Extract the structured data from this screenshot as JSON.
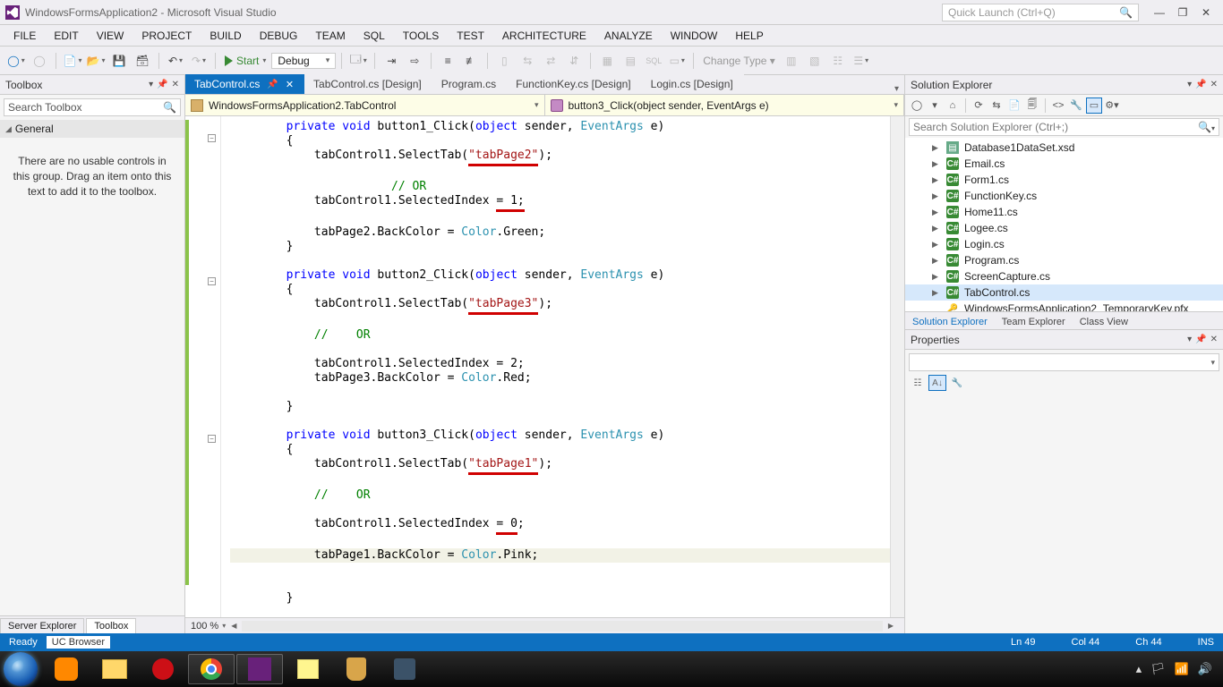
{
  "title": "WindowsFormsApplication2 - Microsoft Visual Studio",
  "quicklaunch_placeholder": "Quick Launch (Ctrl+Q)",
  "menu": [
    "FILE",
    "EDIT",
    "VIEW",
    "PROJECT",
    "BUILD",
    "DEBUG",
    "TEAM",
    "SQL",
    "TOOLS",
    "TEST",
    "ARCHITECTURE",
    "ANALYZE",
    "WINDOW",
    "HELP"
  ],
  "toolbar": {
    "start_label": "Start",
    "config": "Debug",
    "change_type": "Change Type"
  },
  "toolbox": {
    "title": "Toolbox",
    "search_placeholder": "Search Toolbox",
    "group": "General",
    "empty_msg": "There are no usable controls in this group. Drag an item onto this text to add it to the toolbox.",
    "bottom_tabs": [
      "Server Explorer",
      "Toolbox"
    ]
  },
  "editor_tabs": [
    {
      "label": "TabControl.cs",
      "active": true,
      "pinned": true
    },
    {
      "label": "TabControl.cs [Design]"
    },
    {
      "label": "Program.cs"
    },
    {
      "label": "FunctionKey.cs [Design]"
    },
    {
      "label": "Login.cs [Design]"
    }
  ],
  "nav": {
    "class": "WindowsFormsApplication2.TabControl",
    "member": "button3_Click(object sender, EventArgs e)"
  },
  "zoom": "100 %",
  "solution_explorer": {
    "title": "Solution Explorer",
    "search_placeholder": "Search Solution Explorer (Ctrl+;)",
    "items": [
      {
        "name": "Database1DataSet.xsd",
        "icon": "xsd"
      },
      {
        "name": "Email.cs",
        "icon": "cs"
      },
      {
        "name": "Form1.cs",
        "icon": "cs"
      },
      {
        "name": "FunctionKey.cs",
        "icon": "cs"
      },
      {
        "name": "Home11.cs",
        "icon": "cs"
      },
      {
        "name": "Logee.cs",
        "icon": "cs"
      },
      {
        "name": "Login.cs",
        "icon": "cs"
      },
      {
        "name": "Program.cs",
        "icon": "csplain"
      },
      {
        "name": "ScreenCapture.cs",
        "icon": "cs"
      },
      {
        "name": "TabControl.cs",
        "icon": "cs",
        "selected": true
      },
      {
        "name": "WindowsFormsApplication2_TemporaryKey.pfx",
        "icon": "key",
        "noexp": true
      }
    ],
    "bottom_tabs": [
      "Solution Explorer",
      "Team Explorer",
      "Class View"
    ]
  },
  "properties": {
    "title": "Properties"
  },
  "status": {
    "ready": "Ready",
    "uc": "UC Browser",
    "ln": "Ln 49",
    "col": "Col 44",
    "ch": "Ch 44",
    "ins": "INS"
  }
}
